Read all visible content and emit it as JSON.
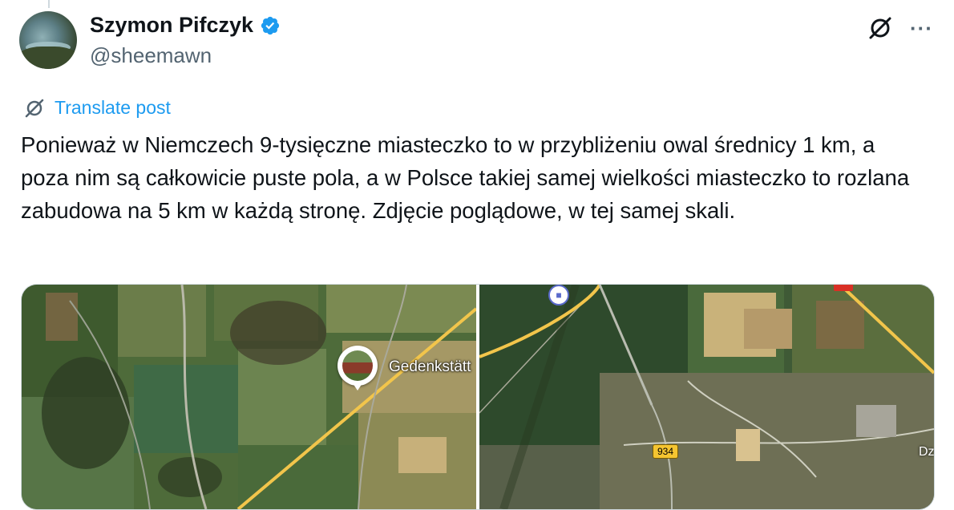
{
  "user": {
    "display_name": "Szymon Pifczyk",
    "handle": "@sheemawn",
    "verified": true
  },
  "actions": {
    "grok_icon": "grok-icon",
    "more_label": "···"
  },
  "translate": {
    "label": "Translate post",
    "icon": "grok-icon"
  },
  "post": {
    "text": "Ponieważ w Niemczech 9-tysięczne miasteczko to w przybliżeniu owal średnicy 1 km, a poza nim są całkowicie puste pola, a w Polsce takiej samej wielkości miasteczko to rozlana zabudowa na 5 km w każdą stronę. Zdjęcie poglądowe, w tej samej skali."
  },
  "media": {
    "left_map": {
      "place_label": "Gedenkstätt"
    },
    "right_map": {
      "road_number": "934",
      "edge_label": "Dz"
    }
  },
  "colors": {
    "link": "#1d9bf0",
    "verified": "#1d9bf0",
    "secondary_text": "#536471"
  }
}
